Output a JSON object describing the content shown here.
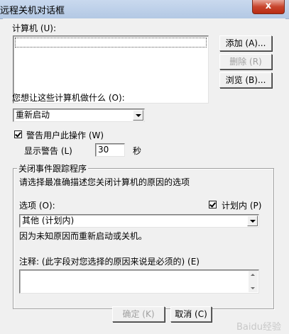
{
  "window": {
    "title": "远程关机对话框",
    "close_glyph": "x"
  },
  "computers": {
    "label": "计算机 (U):",
    "add_label": "添加 (A)...",
    "delete_label": "删除 (R)",
    "browse_label": "浏览 (B)..."
  },
  "action": {
    "label": "您想让这些计算机做什么 (O):",
    "selected": "重新启动"
  },
  "warn": {
    "checkbox_label": "警告用户此操作 (W)",
    "checked": true,
    "display_label": "显示警告 (L)",
    "seconds_value": "30",
    "seconds_unit": "秒"
  },
  "tracker": {
    "group_title": "关闭事件跟踪程序",
    "instruction": "请选择最准确描述您关闭计算机的原因的选项",
    "options_label": "选项 (O):",
    "planned_label": "计划内 (P)",
    "planned_checked": true,
    "option_selected": "其他 (计划内)",
    "reason_text": "因为未知原因而重新启动或关机。",
    "comment_label": "注释: (此字段对您选择的原因来说是必须的) (E)",
    "comment_value": ""
  },
  "footer": {
    "ok_label": "确定 (K)",
    "cancel_label": "取消 (C)",
    "watermark": "Baidu经验"
  }
}
